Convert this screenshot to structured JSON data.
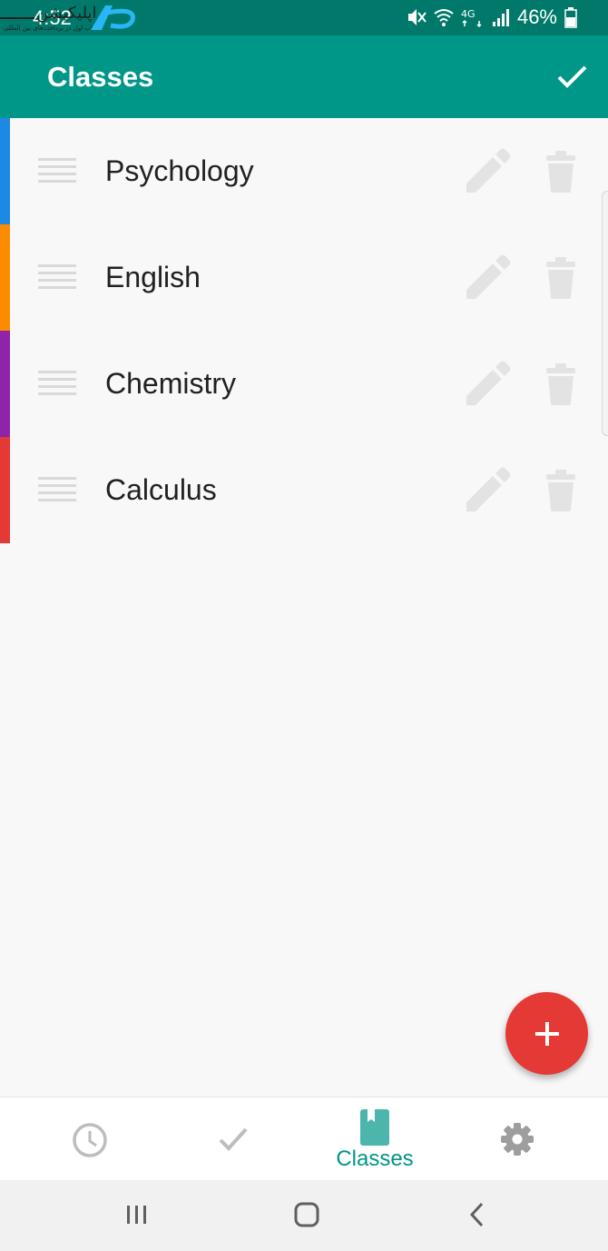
{
  "status_bar": {
    "time": "4:52",
    "battery_percent": "46%",
    "icons": [
      "mute-icon",
      "wifi-icon",
      "lte-icon",
      "signal-icon",
      "battery-icon"
    ]
  },
  "app_bar": {
    "title": "Classes",
    "action_icon": "check-icon"
  },
  "classes": [
    {
      "name": "Psychology",
      "color": "#1e88e5"
    },
    {
      "name": "English",
      "color": "#fb8c00"
    },
    {
      "name": "Chemistry",
      "color": "#8e24aa"
    },
    {
      "name": "Calculus",
      "color": "#e53935"
    }
  ],
  "fab": {
    "icon": "plus-icon",
    "color": "#e53935"
  },
  "bottom_nav": {
    "items": [
      {
        "icon": "clock-icon",
        "label": ""
      },
      {
        "icon": "check-icon",
        "label": ""
      },
      {
        "icon": "book-icon",
        "label": "Classes",
        "active": true
      },
      {
        "icon": "gear-icon",
        "label": ""
      }
    ]
  },
  "colors": {
    "primary": "#009688",
    "primary_dark": "#00796b",
    "accent": "#e53935"
  }
}
